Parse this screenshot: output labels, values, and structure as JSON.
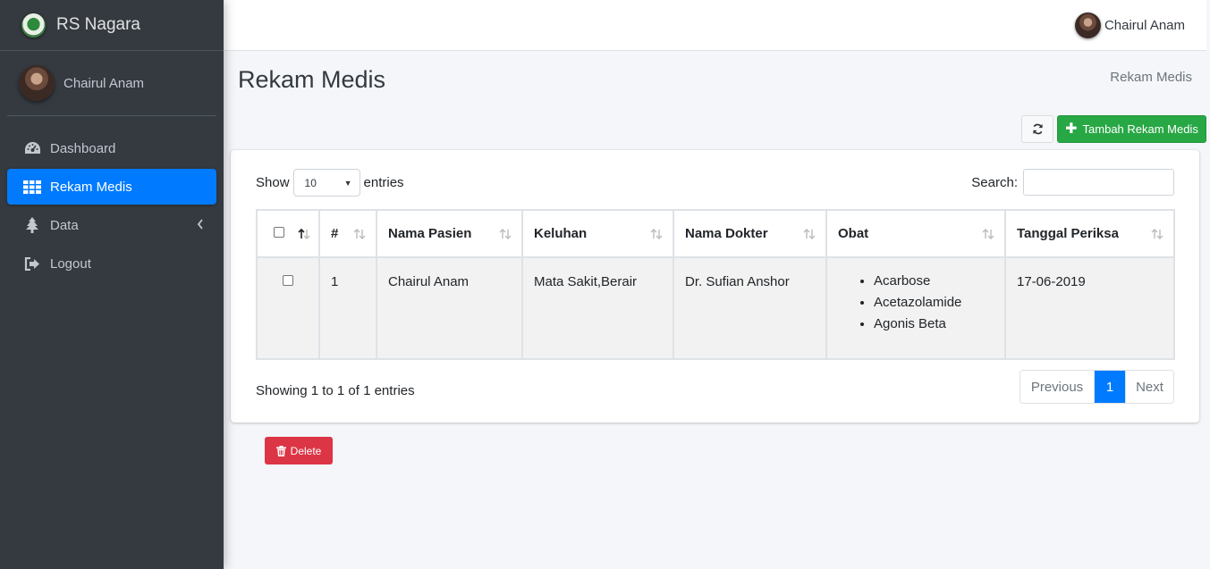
{
  "brand": {
    "name": "RS Nagara"
  },
  "user": {
    "name": "Chairul Anam"
  },
  "sidebar": {
    "items": [
      {
        "label": "Dashboard",
        "icon": "dashboard-icon"
      },
      {
        "label": "Rekam Medis",
        "icon": "table-icon",
        "active": true
      },
      {
        "label": "Data",
        "icon": "tree-icon"
      },
      {
        "label": "Logout",
        "icon": "sign-out-icon"
      }
    ]
  },
  "topbar": {
    "user_name": "Chairul Anam"
  },
  "page": {
    "title": "Rekam Medis",
    "breadcrumb": "Rekam Medis"
  },
  "toolbar": {
    "add_label": "Tambah Rekam Medis"
  },
  "table_controls": {
    "show_label": "Show",
    "entries_label": "entries",
    "page_length": "10",
    "search_label": "Search:",
    "search_value": ""
  },
  "table": {
    "columns": [
      "",
      "#",
      "Nama Pasien",
      "Keluhan",
      "Nama Dokter",
      "Obat",
      "Tanggal Periksa"
    ],
    "rows": [
      {
        "no": "1",
        "nama_pasien": "Chairul Anam",
        "keluhan": "Mata Sakit,Berair",
        "nama_dokter": "Dr. Sufian Anshor",
        "obat": [
          "Acarbose",
          "Acetazolamide",
          "Agonis Beta"
        ],
        "tanggal_periksa": "17-06-2019"
      }
    ]
  },
  "footer": {
    "info": "Showing 1 to 1 of 1 entries",
    "prev_label": "Previous",
    "current_page": "1",
    "next_label": "Next"
  },
  "actions": {
    "delete_label": "Delete"
  },
  "colors": {
    "primary": "#007bff",
    "success": "#28a745",
    "danger": "#dc3545",
    "sidebar": "#343a40"
  }
}
